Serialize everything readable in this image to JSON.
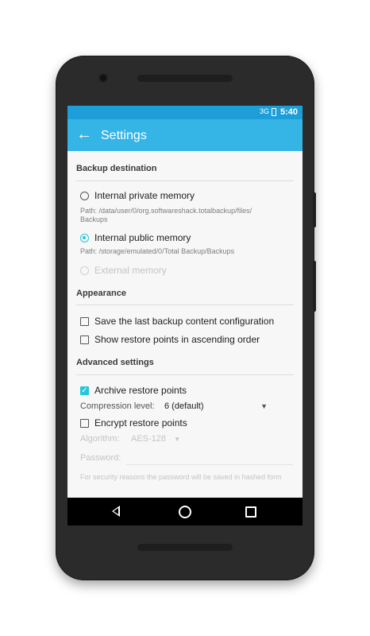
{
  "status_bar": {
    "time": "5:40",
    "signal": "3G"
  },
  "app_bar": {
    "title": "Settings"
  },
  "backup_destination": {
    "title": "Backup destination",
    "options": [
      {
        "label": "Internal private memory",
        "path": "Path: /data/user/0/org.softwareshack.totalbackup/files/\nBackups",
        "selected": false,
        "enabled": true
      },
      {
        "label": "Internal public memory",
        "path": "Path: /storage/emulated/0/Total Backup/Backups",
        "selected": true,
        "enabled": true
      },
      {
        "label": "External memory",
        "path": "",
        "selected": false,
        "enabled": false
      }
    ]
  },
  "appearance": {
    "title": "Appearance",
    "items": [
      {
        "label": "Save the last backup content configuration",
        "checked": false
      },
      {
        "label": "Show restore points in ascending order",
        "checked": false
      }
    ]
  },
  "advanced": {
    "title": "Advanced settings",
    "archive_label": "Archive restore points",
    "archive_checked": true,
    "compression_label": "Compression level:",
    "compression_value": "6 (default)",
    "encrypt_label": "Encrypt restore points",
    "encrypt_checked": false,
    "algorithm_label": "Algorithm:",
    "algorithm_value": "AES-128",
    "password_label": "Password:",
    "password_note": "For security reasons the password will be saved in hashed form"
  },
  "colors": {
    "status_bar": "#1e9ed8",
    "app_bar": "#35b5e5",
    "accent": "#26c6da"
  },
  "icons": [
    "back-arrow-icon",
    "signal-icon",
    "battery-icon",
    "nav-back-icon",
    "nav-home-icon",
    "nav-recents-icon",
    "dropdown-arrow-icon"
  ]
}
